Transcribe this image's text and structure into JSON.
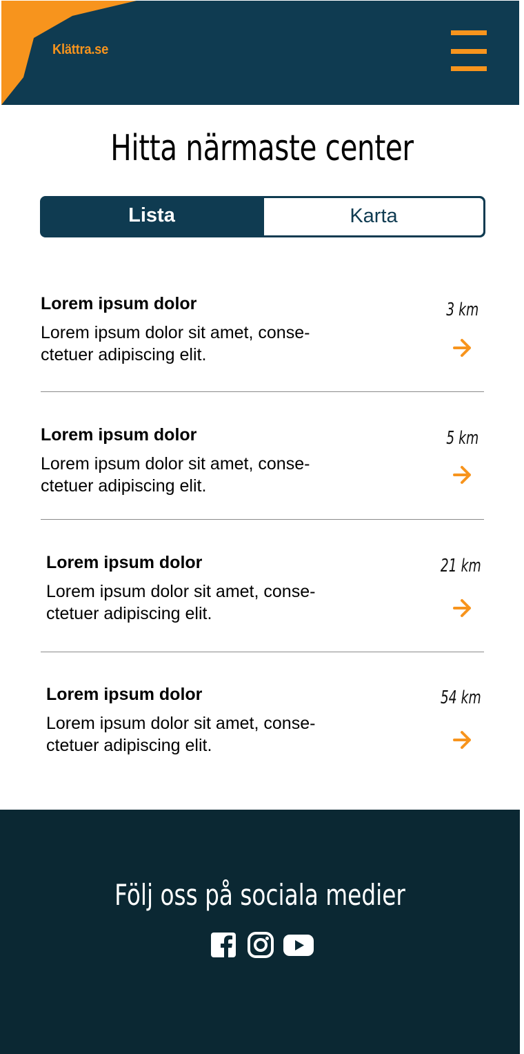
{
  "header": {
    "logo": "Klättra.se",
    "menu_icon": "hamburger-menu-icon"
  },
  "colors": {
    "primary": "#0f3b51",
    "accent": "#f7941d",
    "footer": "#0b2833"
  },
  "page_title": "Hitta närmaste center",
  "toggle": {
    "options": [
      {
        "label": "Lista",
        "active": true
      },
      {
        "label": "Karta",
        "active": false
      }
    ]
  },
  "centers": [
    {
      "title": "Lorem ipsum dolor",
      "description": "Lorem ipsum dolor sit amet, conse-ctetuer adipiscing elit.",
      "distance": "3 km",
      "icon": "arrow-right-icon"
    },
    {
      "title": "Lorem ipsum dolor",
      "description": "Lorem ipsum dolor sit amet, conse-ctetuer adipiscing elit.",
      "distance": "5 km",
      "icon": "arrow-right-icon"
    },
    {
      "title": "Lorem ipsum dolor",
      "description": "Lorem ipsum dolor sit amet, conse-ctetuer adipiscing elit.",
      "distance": "21 km",
      "icon": "arrow-right-icon"
    },
    {
      "title": "Lorem ipsum dolor",
      "description": "Lorem ipsum dolor sit amet, conse-ctetuer adipiscing elit.",
      "distance": "54 km",
      "icon": "arrow-right-icon"
    }
  ],
  "footer": {
    "title": "Följ oss på sociala medier",
    "social": [
      "facebook-icon",
      "instagram-icon",
      "youtube-icon"
    ]
  }
}
